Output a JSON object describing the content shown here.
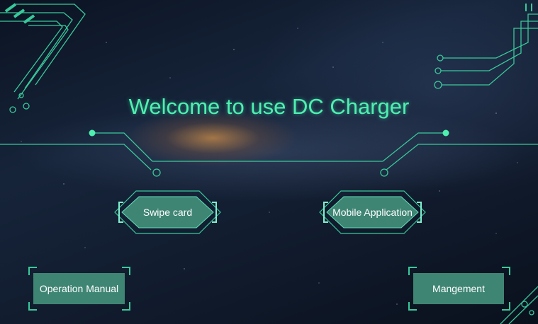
{
  "title": "Welcome to use DC Charger",
  "buttons": {
    "swipe_card": "Swipe card",
    "mobile_app": "Mobile Application",
    "operation_manual": "Operation Manual",
    "management": "Mangement"
  },
  "colors": {
    "accent": "#4ff0b0",
    "circuit": "#39c99b",
    "button_fill": "#3f8574"
  }
}
